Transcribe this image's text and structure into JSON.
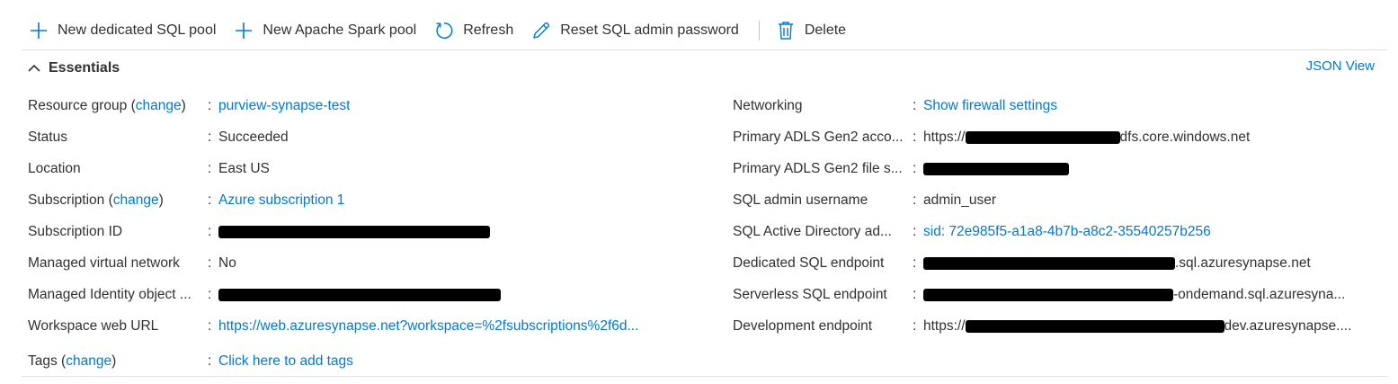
{
  "toolbar": {
    "new_sql_pool": "New dedicated SQL pool",
    "new_spark_pool": "New Apache Spark pool",
    "refresh": "Refresh",
    "reset_password": "Reset SQL admin password",
    "delete": "Delete"
  },
  "essentials": {
    "title": "Essentials",
    "json_view": "JSON View"
  },
  "left": {
    "resource_group": {
      "label_pre": "Resource group (",
      "change": "change",
      "label_post": ")",
      "value": "purview-synapse-test"
    },
    "status": {
      "label": "Status",
      "value": "Succeeded"
    },
    "location": {
      "label": "Location",
      "value": "East US"
    },
    "subscription": {
      "label_pre": "Subscription (",
      "change": "change",
      "label_post": ")",
      "value": "Azure subscription 1"
    },
    "subscription_id": {
      "label": "Subscription ID"
    },
    "managed_vnet": {
      "label": "Managed virtual network",
      "value": "No"
    },
    "managed_identity": {
      "label": "Managed Identity object ..."
    },
    "workspace_url": {
      "label": "Workspace web URL",
      "value": "https://web.azuresynapse.net?workspace=%2fsubscriptions%2f6d..."
    },
    "tags": {
      "label_pre": "Tags (",
      "change": "change",
      "label_post": ")",
      "value": "Click here to add tags"
    }
  },
  "right": {
    "networking": {
      "label": "Networking",
      "value": "Show firewall settings"
    },
    "adls_account": {
      "label": "Primary ADLS Gen2 acco...",
      "prefix": "https://",
      "suffix": "dfs.core.windows.net"
    },
    "adls_file": {
      "label": "Primary ADLS Gen2 file s..."
    },
    "sql_admin": {
      "label": "SQL admin username",
      "value": "admin_user"
    },
    "aad_admin": {
      "label": "SQL Active Directory ad...",
      "value": "sid: 72e985f5-a1a8-4b7b-a8c2-35540257b256"
    },
    "dedicated_endpoint": {
      "label": "Dedicated SQL endpoint",
      "suffix": ".sql.azuresynapse.net"
    },
    "serverless_endpoint": {
      "label": "Serverless SQL endpoint",
      "suffix": "-ondemand.sql.azuresyna..."
    },
    "dev_endpoint": {
      "label": "Development endpoint",
      "prefix": "https://",
      "suffix": "dev.azuresynapse...."
    }
  },
  "colon": ":",
  "colors": {
    "link": "#0078d4",
    "text": "#323130",
    "divider": "#e1dfdd"
  }
}
